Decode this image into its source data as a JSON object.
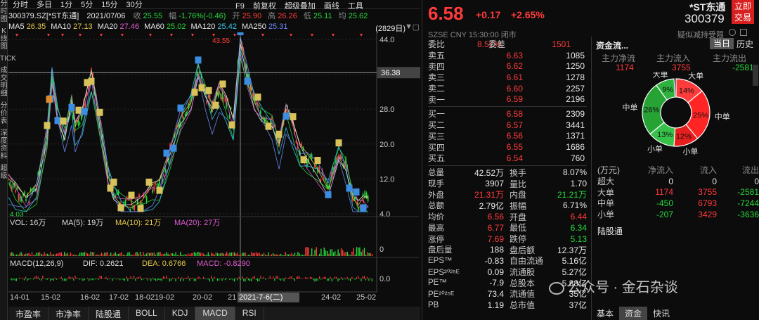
{
  "left_toolbar": [
    "分时图",
    "K线图",
    "TICK",
    "成交明细",
    "分价表",
    "深度资料",
    "超级"
  ],
  "top_bar": {
    "items": [
      "分时",
      "多日",
      "1分",
      "5分",
      "15分",
      "30分"
    ],
    "right_items": [
      "F9",
      "前复权",
      "超级叠加",
      "画线",
      "工具"
    ]
  },
  "info_bar": {
    "code": "300379.SZ[*ST东通]",
    "date": "2021/07/06",
    "close_label": "收",
    "close": "25.55",
    "chg_label": "幅",
    "chg": "-1.76%(-0.46)",
    "open_label": "开",
    "open": "25.90",
    "high_label": "高",
    "high": "26.26",
    "low_label": "低",
    "low": "25.11",
    "avg_label": "均",
    "avg": "25.62"
  },
  "ma_bar": {
    "ma5": "MA5",
    "ma5v": "26.35",
    "ma10": "MA10",
    "ma10v": "27.13",
    "ma20": "MA20",
    "ma20v": "27.46",
    "ma60": "MA60",
    "ma60v": "25.02",
    "ma120": "MA120",
    "ma120v": "25.42",
    "ma250": "MA250",
    "ma250v": "25.31",
    "days": "(2829日)"
  },
  "chart_data": {
    "type": "candlestick",
    "y_ticks": [
      "44.0",
      "36.0",
      "28.0",
      "20.0",
      "12.0",
      "4.0"
    ],
    "x_ticks": [
      "14-01",
      "15-02",
      "16-02",
      "17-02",
      "18-02",
      "19-02",
      "20-02",
      "21",
      "22",
      "23",
      "24-02",
      "25-02"
    ],
    "crosshair_price": "36.38",
    "crosshair_date": "2021-7-6(二)",
    "max_label": "43.55",
    "min_label": "4.03",
    "vol_label": "VOL: 16万",
    "vol_ma5": "MA(5): 19万",
    "vol_ma10": "MA(10): 21万",
    "vol_ma20": "MA(20): 27万",
    "vol_tick": "0",
    "macd_label": "MACD(12,26,9)",
    "dif": "DIF: 0.2621",
    "dea": "DEA: 0.6766",
    "macd": "MACD: -0.8290",
    "macd_tick": "0.0"
  },
  "bottom_tabs": [
    "市盈率",
    "市净率",
    "陆股通",
    "BOLL",
    "KDJ",
    "MACD",
    "RSI"
  ],
  "quote": {
    "price": "6.58",
    "change": "+0.17",
    "pct": "+2.65%",
    "name": "*ST东通",
    "code": "300379",
    "btn1": "立即",
    "btn2": "交易",
    "market": "SZSE",
    "currency": "CNY",
    "time": "15:30:00",
    "status": "闭市",
    "tag": "疑似减持受限"
  },
  "weibi": {
    "label1": "委比",
    "v1": "8.51%",
    "label2": "委差",
    "v2": "1501"
  },
  "asks": [
    {
      "l": "卖五",
      "p": "6.63",
      "v": "1085"
    },
    {
      "l": "卖四",
      "p": "6.62",
      "v": "1250"
    },
    {
      "l": "卖三",
      "p": "6.61",
      "v": "1278"
    },
    {
      "l": "卖二",
      "p": "6.60",
      "v": "2257"
    },
    {
      "l": "卖一",
      "p": "6.59",
      "v": "2196"
    }
  ],
  "bids": [
    {
      "l": "买一",
      "p": "6.58",
      "v": "2309"
    },
    {
      "l": "买二",
      "p": "6.57",
      "v": "3441"
    },
    {
      "l": "买三",
      "p": "6.56",
      "v": "1371"
    },
    {
      "l": "买四",
      "p": "6.55",
      "v": "1686"
    },
    {
      "l": "买五",
      "p": "6.54",
      "v": "760"
    }
  ],
  "stats": [
    [
      "总量",
      "42.52万",
      "换手",
      "8.07%"
    ],
    [
      "现手",
      "3907",
      "量比",
      "1.70"
    ],
    [
      "外盘",
      "21.31万",
      "内盘",
      "21.21万"
    ],
    [
      "总额",
      "2.79亿",
      "振幅",
      "6.71%"
    ],
    [
      "均价",
      "6.56",
      "开盘",
      "6.44"
    ],
    [
      "最高",
      "6.77",
      "最低",
      "6.34"
    ],
    [
      "涨停",
      "7.69",
      "跌停",
      "5.13"
    ],
    [
      "盘后量",
      "188",
      "盘后额",
      "12.37万"
    ],
    [
      "EPS™",
      "-0.83",
      "自由流通",
      "5.16亿"
    ],
    [
      "EPS²⁰²⁵ᴱ",
      "0.09",
      "流通股",
      "5.27亿"
    ],
    [
      "PE™",
      "-7.9",
      "总股本",
      "5.88亿"
    ],
    [
      "PE²⁰²⁵ᴱ",
      "73.4",
      "流通值",
      "35亿"
    ],
    [
      "PB",
      "1.19",
      "总市值",
      "37亿"
    ]
  ],
  "fund": {
    "title": "资金流...",
    "tab1": "当日",
    "tab2": "历史",
    "h1": "主力净流",
    "h2": "主力流入",
    "h3": "主力流出",
    "v1": "1174",
    "v2": "3755",
    "v3": "-2581",
    "pie": [
      {
        "name": "大单",
        "pct": "9%",
        "side": "out",
        "frac": 0.09
      },
      {
        "name": "中单",
        "pct": "26%",
        "side": "out",
        "frac": 0.26
      },
      {
        "name": "小单",
        "pct": "13%",
        "side": "out",
        "frac": 0.13
      },
      {
        "name": "大单",
        "pct": "14%",
        "side": "in",
        "frac": 0.14
      },
      {
        "name": "中单",
        "pct": "25%",
        "side": "in",
        "frac": 0.25
      },
      {
        "name": "小单",
        "pct": "12%",
        "side": "in",
        "frac": 0.12
      }
    ],
    "table_head": [
      "(万元)",
      "净流入",
      "流入",
      "流出"
    ],
    "rows": [
      [
        "超大",
        "0",
        "0",
        "0"
      ],
      [
        "大单",
        "1174",
        "3755",
        "-2581"
      ],
      [
        "中单",
        "-450",
        "6793",
        "-7244"
      ],
      [
        "小单",
        "-207",
        "3429",
        "-3636"
      ]
    ],
    "lgt": "陆股通"
  },
  "right_tabs": [
    "基本",
    "资金",
    "快讯"
  ],
  "watermark": "公众号 · 金石杂谈"
}
